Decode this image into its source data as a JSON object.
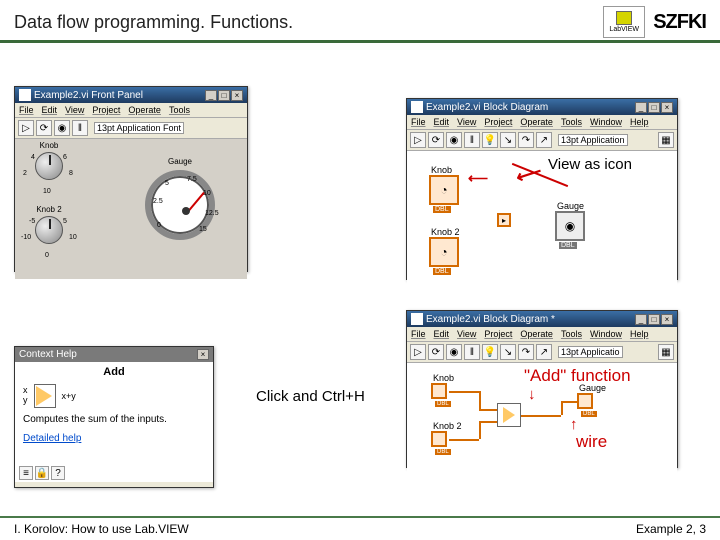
{
  "header": {
    "title": "Data flow programming. Functions.",
    "labview": "LabVIEW",
    "szfki": "SZFKI"
  },
  "footer": {
    "left": "I. Korolov: How to use Lab.VIEW",
    "right": "Example 2, 3"
  },
  "front_panel": {
    "title": "Example2.vi Front Panel",
    "menu": [
      "File",
      "Edit",
      "View",
      "Project",
      "Operate",
      "Tools"
    ],
    "toolbar_font": "13pt Application Font",
    "knob_label": "Knob",
    "knob2_label": "Knob 2",
    "gauge_label": "Gauge",
    "knob_ticks": [
      "2",
      "4",
      "6",
      "8",
      "10"
    ],
    "knob2_ticks": [
      "-10",
      "-5",
      "0",
      "5",
      "10"
    ],
    "gauge_ticks": [
      "0",
      "2.5",
      "5",
      "7.5",
      "10",
      "12.5",
      "15"
    ]
  },
  "bd1": {
    "title": "Example2.vi Block Diagram",
    "menu": [
      "File",
      "Edit",
      "View",
      "Project",
      "Operate",
      "Tools",
      "Window",
      "Help"
    ],
    "toolbar_font": "13pt Application",
    "knob_label": "Knob",
    "knob2_label": "Knob 2",
    "gauge_label": "Gauge",
    "dbl": "DBL"
  },
  "bd2": {
    "title": "Example2.vi Block Diagram *",
    "menu": [
      "File",
      "Edit",
      "View",
      "Project",
      "Operate",
      "Tools",
      "Window",
      "Help"
    ],
    "toolbar_font": "13pt Applicatio",
    "knob_label": "Knob",
    "knob2_label": "Knob 2",
    "gauge_label": "Gauge",
    "dbl": "DBL"
  },
  "ctx_help": {
    "title": "Context Help",
    "heading": "Add",
    "inputs": "x\ny",
    "output": "x+y",
    "desc": "Computes the sum of the inputs.",
    "link": "Detailed help",
    "close": "×"
  },
  "annotations": {
    "view_as_icon": "View as icon",
    "click_ctrl_h": "Click and Ctrl+H",
    "add_function": "\"Add\" function",
    "wire": "wire"
  }
}
